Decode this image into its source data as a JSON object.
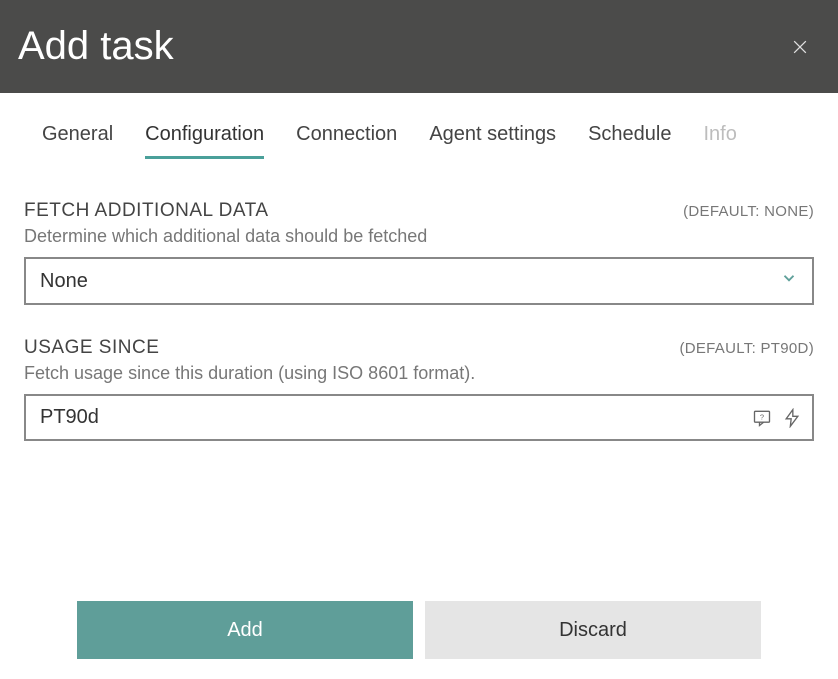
{
  "header": {
    "title": "Add task"
  },
  "tabs": [
    {
      "label": "General",
      "active": false,
      "disabled": false
    },
    {
      "label": "Configuration",
      "active": true,
      "disabled": false
    },
    {
      "label": "Connection",
      "active": false,
      "disabled": false
    },
    {
      "label": "Agent settings",
      "active": false,
      "disabled": false
    },
    {
      "label": "Schedule",
      "active": false,
      "disabled": false
    },
    {
      "label": "Info",
      "active": false,
      "disabled": true
    }
  ],
  "fields": {
    "fetch_additional": {
      "label": "FETCH ADDITIONAL DATA",
      "default_text": "(DEFAULT: NONE)",
      "description": "Determine which additional data should be fetched",
      "value": "None"
    },
    "usage_since": {
      "label": "USAGE SINCE",
      "default_text": "(DEFAULT: PT90D)",
      "description": "Fetch usage since this duration (using ISO 8601 format).",
      "value": "PT90d"
    }
  },
  "footer": {
    "add_label": "Add",
    "discard_label": "Discard"
  }
}
